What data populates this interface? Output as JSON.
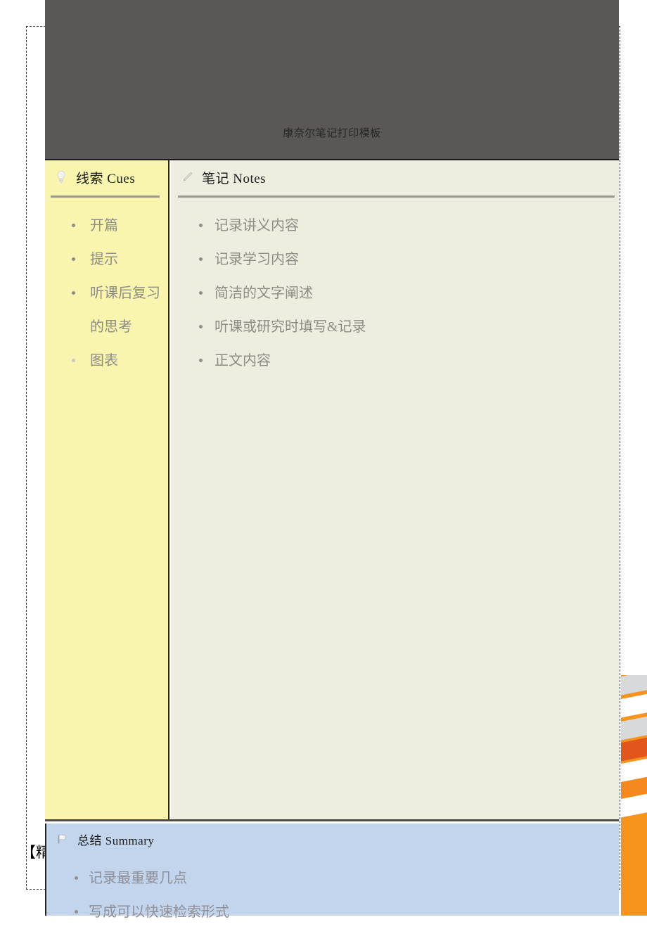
{
  "background": {
    "left_fragment_text": "【精"
  },
  "slide": {
    "title": "康奈尔笔记打印模板",
    "cues": {
      "icon": "lightbulb-icon",
      "header": "线索 Cues",
      "items": [
        "开篇",
        "提示",
        "听课后复习的思考",
        "图表"
      ]
    },
    "notes": {
      "icon": "pencil-icon",
      "header": "笔记 Notes",
      "items": [
        "记录讲义内容",
        "记录学习内容",
        "简洁的文字阐述",
        "听课或研究时填写&记录",
        "正文内容"
      ]
    },
    "summary": {
      "icon": "flag-icon",
      "header": "总结 Summary",
      "items": [
        "记录最重要几点",
        "写成可以快速检索形式"
      ]
    }
  },
  "colors": {
    "title_band": "#595857",
    "cues_bg": "#FAF5AE",
    "notes_bg": "#EDEDE0",
    "summary_bg": "#C2D5EC",
    "accent_orange": "#F7941E",
    "accent_orange_dark": "#E2561C",
    "bullet_text": "#8d8d86"
  }
}
